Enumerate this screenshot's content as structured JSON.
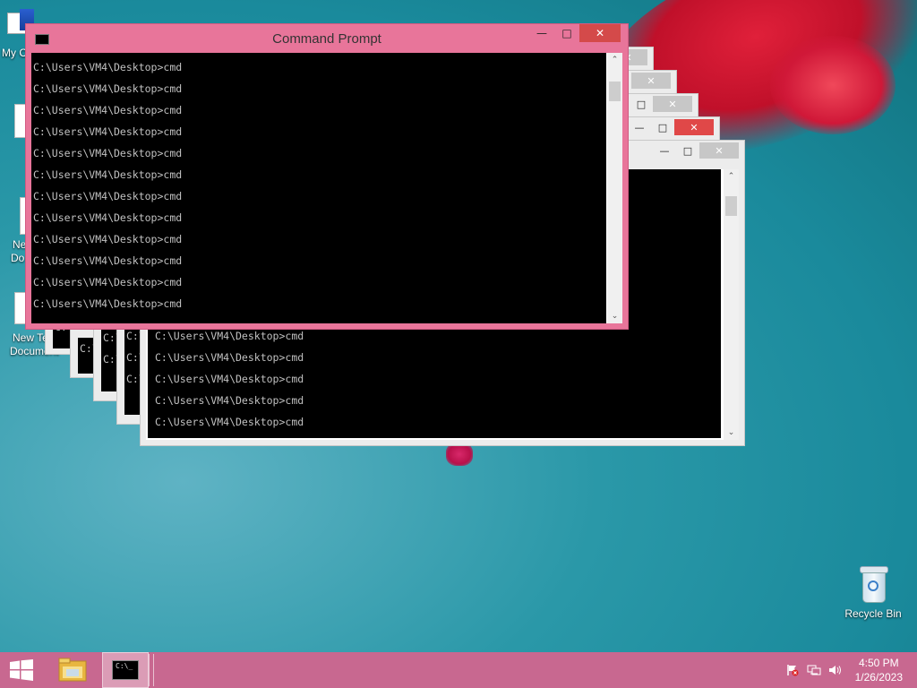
{
  "desktop": {
    "icons": {
      "my_computer": "My Computer",
      "new_doc_1": "New Text Document",
      "new_doc_2_line1": "New Te",
      "new_doc_2_line2": "Document",
      "recycle_bin": "Recycle Bin"
    },
    "partial_labels": {
      "my_computer": "My C",
      "doc_a": "Ne",
      "doc_b": "Do"
    }
  },
  "main_window": {
    "title": "Command Prompt",
    "minimize": "—",
    "maximize": "□",
    "close": "✕",
    "lines": [
      "C:\\Users\\VM4\\Desktop>cmd",
      "C:\\Users\\VM4\\Desktop>cmd",
      "C:\\Users\\VM4\\Desktop>cmd",
      "C:\\Users\\VM4\\Desktop>cmd",
      "C:\\Users\\VM4\\Desktop>cmd",
      "C:\\Users\\VM4\\Desktop>cmd",
      "C:\\Users\\VM4\\Desktop>cmd",
      "C:\\Users\\VM4\\Desktop>cmd",
      "C:\\Users\\VM4\\Desktop>cmd",
      "C:\\Users\\VM4\\Desktop>cmd",
      "C:\\Users\\VM4\\Desktop>cmd",
      "C:\\Users\\VM4\\Desktop>cmd"
    ]
  },
  "back_window": {
    "lines": [
      "C:\\Users\\VM4\\Desktop>cmd",
      "C:\\Users\\VM4\\Desktop>cmd",
      "C:\\Users\\VM4\\Desktop>cmd",
      "C:\\Users\\VM4\\Desktop>cmd",
      "C:\\Users\\VM4\\Desktop>cmd"
    ]
  },
  "stacked_prefix": "C:\\",
  "taskbar": {
    "time": "4:50 PM",
    "date": "1/26/2023",
    "cmd_icon_text": "C:\\_"
  },
  "colors": {
    "active_frame": "#e8759a",
    "taskbar": "#c86890",
    "close_red": "#e04848"
  }
}
